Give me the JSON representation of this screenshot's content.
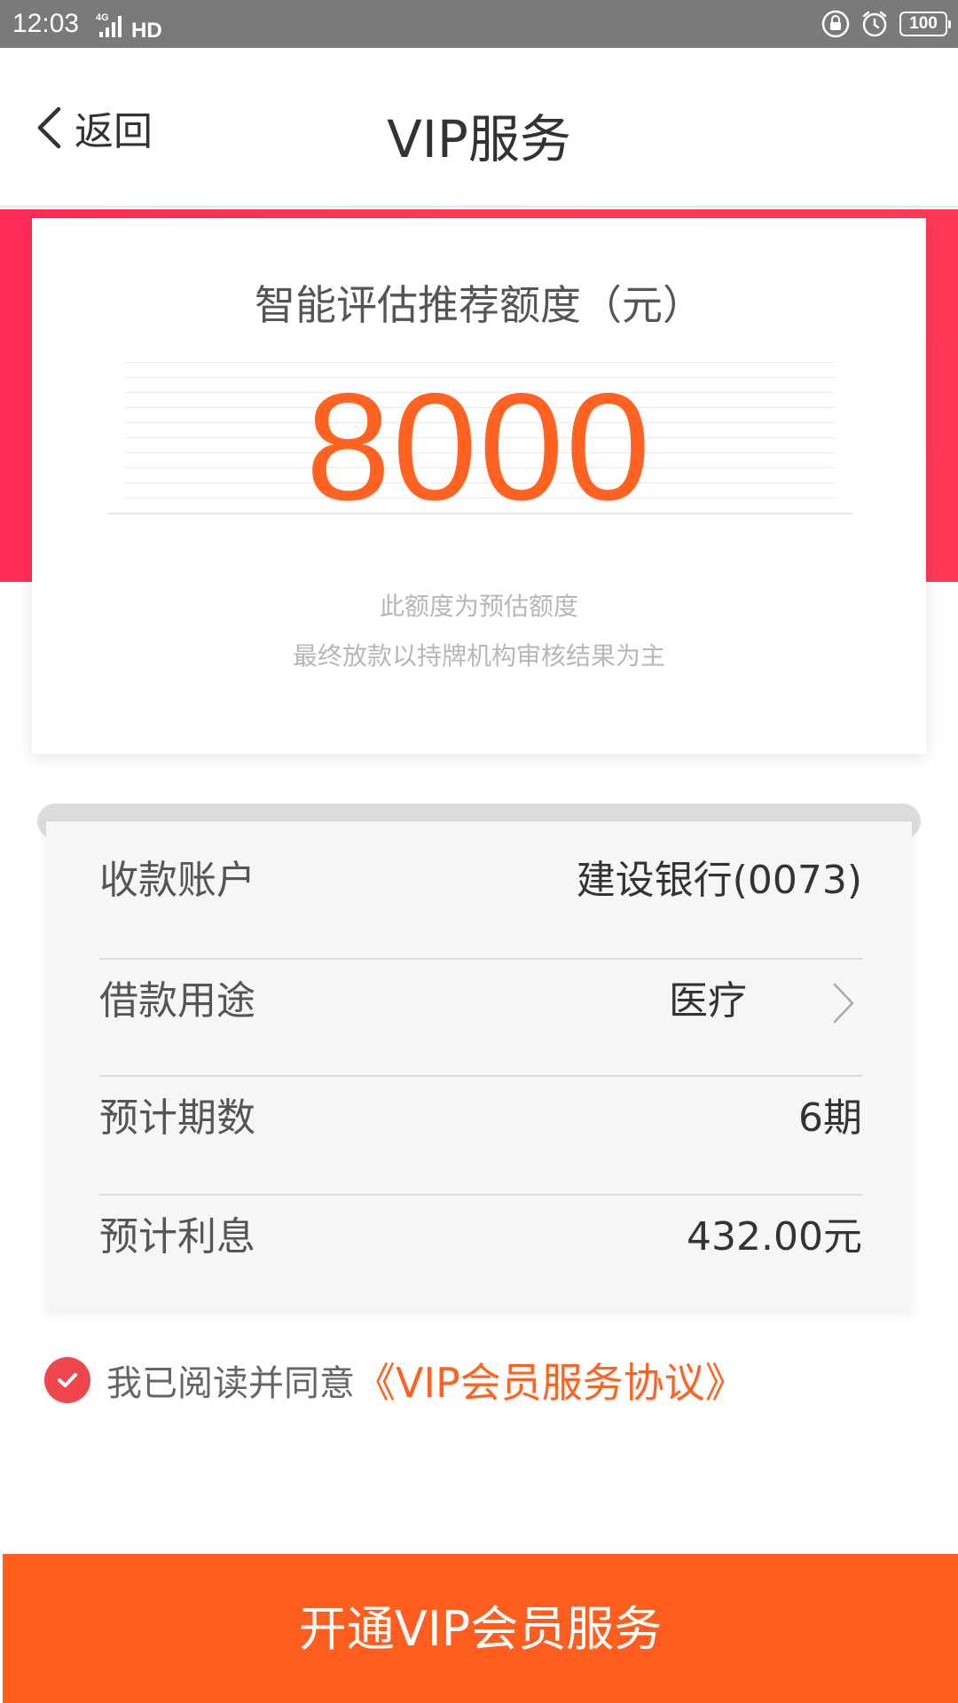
{
  "status_bar": {
    "time": "12:03",
    "network": "4G",
    "hd": "HD",
    "battery": "100"
  },
  "nav": {
    "back_label": "返回",
    "title": "VIP服务"
  },
  "amount_card": {
    "title": "智能评估推荐额度（元）",
    "amount": "8000",
    "note_line1": "此额度为预估额度",
    "note_line2": "最终放款以持牌机构审核结果为主"
  },
  "info": {
    "rows": [
      {
        "label": "收款账户",
        "value": "建设银行(0073)"
      },
      {
        "label": "借款用途",
        "value": "医疗"
      },
      {
        "label": "预计期数",
        "value": "6期"
      },
      {
        "label": "预计利息",
        "value": "432.00元"
      }
    ]
  },
  "agreement": {
    "checked": true,
    "text": "我已阅读并同意",
    "link": "《VIP会员服务协议》"
  },
  "cta": {
    "label": "开通VIP会员服务"
  },
  "colors": {
    "accent_orange": "#ff6221",
    "band_red": "#ff2c55",
    "check_red": "#f0464d",
    "status_bar_gray": "#7a7a7a"
  },
  "icons": [
    "back-chevron-icon",
    "signal-icon",
    "lock-icon",
    "alarm-icon",
    "battery-icon",
    "chevron-right-icon",
    "check-icon"
  ]
}
